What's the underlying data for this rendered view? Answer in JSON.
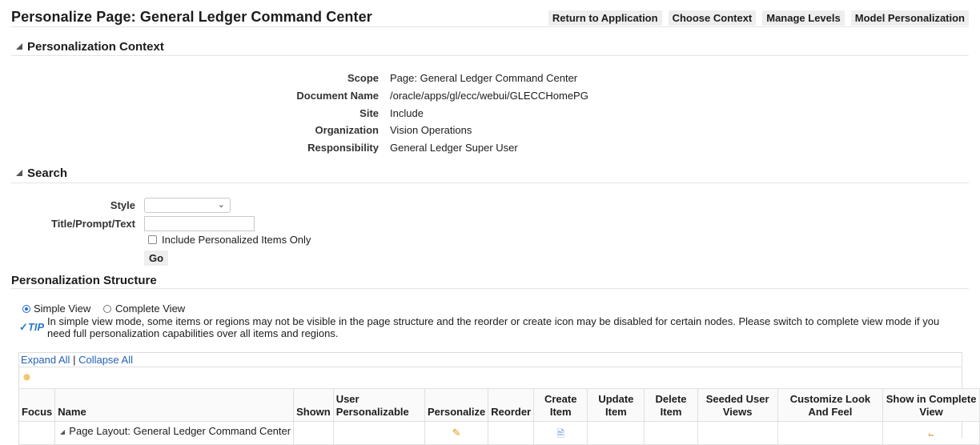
{
  "page": {
    "title": "Personalize Page: General Ledger Command Center",
    "buttons": [
      "Return to Application",
      "Choose Context",
      "Manage Levels",
      "Model Personalization"
    ]
  },
  "context": {
    "heading": "Personalization Context",
    "rows": [
      {
        "label": "Scope",
        "value": "Page: General Ledger Command Center"
      },
      {
        "label": "Document Name",
        "value": "/oracle/apps/gl/ecc/webui/GLECCHomePG"
      },
      {
        "label": "Site",
        "value": "Include"
      },
      {
        "label": "Organization",
        "value": "Vision Operations"
      },
      {
        "label": "Responsibility",
        "value": "General Ledger Super User"
      }
    ]
  },
  "search": {
    "heading": "Search",
    "style_label": "Style",
    "style_value": "",
    "title_label": "Title/Prompt/Text",
    "title_value": "",
    "include_label": "Include Personalized Items Only",
    "include_checked": false,
    "go_label": "Go"
  },
  "structure": {
    "heading": "Personalization Structure",
    "simple_view_label": "Simple View",
    "complete_view_label": "Complete View",
    "selected_view": "Simple View",
    "tip_label": "TIP",
    "tip_text": "In simple view mode, some items or regions may not be visible in the page structure and the reorder or create icon may be disabled for certain nodes. Please switch to complete view mode if you need full personalization capabilities over all items and regions.",
    "expand_all": "Expand All",
    "separator": "|",
    "collapse_all": "Collapse All",
    "columns": [
      "Focus",
      "Name",
      "Shown",
      "User Personalizable",
      "Personalize",
      "Reorder",
      "Create Item",
      "Update Item",
      "Delete Item",
      "Seeded User Views",
      "Customize Look And Feel",
      "Show in Complete View"
    ],
    "rows": [
      {
        "name": "Page Layout: General Ledger Command Center"
      }
    ]
  },
  "icons": {
    "collapse": "collapse-triangle-icon",
    "add": "add-item-icon",
    "personalize": "pencil-icon",
    "create": "create-item-icon",
    "complete_view": "hierarchy-icon",
    "tip": "check-circle-icon"
  }
}
